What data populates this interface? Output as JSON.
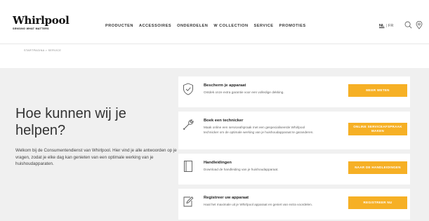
{
  "header": {
    "logo": "Whirlpool",
    "tagline": "SENSING WHAT MATTERS",
    "nav": [
      "PRODUCTEN",
      "ACCESSOIRES",
      "ONDERDELEN",
      "W COLLECTION",
      "SERVICE",
      "PROMOTIES"
    ],
    "lang_active": "NL",
    "lang_sep": "|",
    "lang_other": "FR",
    "icons": [
      "search-icon",
      "location-pin-icon"
    ]
  },
  "breadcrumb": "STARTPAGINA > SERVICE",
  "hero": {
    "title": "Hoe kunnen wij je helpen?",
    "text": "Welkom bij de Consumentendienst van Whirlpool. Hier vind je alle antwoorden op je vragen, zodat je elke dag kan genieten van een optimale werking van je huishoudapparaten."
  },
  "cards": [
    {
      "icon": "shield-check-icon",
      "title": "Bescherm je apparaat",
      "desc": "Ontdek onze extra garantie voor een volledige dekking.",
      "button": "MEER WETEN"
    },
    {
      "icon": "wrench-icon",
      "title": "Boek een technicker",
      "desc": "Maak online een serviceafspraak met een gespecialiseerde Whirlpool technicker om de optimale werking van je huishoudapparaat te garanderen.",
      "button": "ONLINE SERVICEAFSPRAAK MAKEN"
    },
    {
      "icon": "manual-book-icon",
      "title": "Handleidingen",
      "desc": "Download de handleiding van je huishoudapparaat.",
      "button": "NAAR DE HANDLEIDINGEN"
    },
    {
      "icon": "register-edit-icon",
      "title": "Registreer uw apparaat",
      "desc": "Haal het maximale uit je Whirlpool apparaat en geniet van extra voordelen.",
      "button": "REGISTREER NU"
    }
  ],
  "colors": {
    "accent": "#f6b025",
    "background": "#f0f0f0"
  }
}
